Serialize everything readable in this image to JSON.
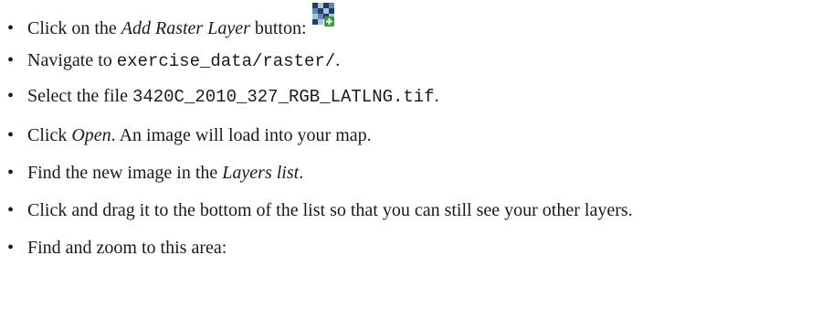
{
  "steps": [
    {
      "pre": "Click on the ",
      "em": "Add Raster Layer",
      "post": " button:",
      "icon": "add-raster-layer-icon"
    },
    {
      "pre": "Navigate to ",
      "mono": "exercise_data/raster/",
      "post": "."
    },
    {
      "pre": "Select the file ",
      "mono": "3420C_2010_327_RGB_LATLNG.tif",
      "post": "."
    },
    {
      "pre": "Click ",
      "em": "Open",
      "post": ". An image will load into your map."
    },
    {
      "pre": "Find the new image in the ",
      "em": "Layers list",
      "post": "."
    },
    {
      "text": "Click and drag it to the bottom of the list so that you can still see your other layers."
    },
    {
      "text": "Find and zoom to this area:"
    }
  ],
  "bullet": "•",
  "colors": {
    "text": "#1a1a1a",
    "icon_dark": "#1f3d66",
    "icon_mid": "#5f86b5",
    "icon_light": "#a9c2de",
    "icon_plus_bg": "#3c9a3c"
  }
}
